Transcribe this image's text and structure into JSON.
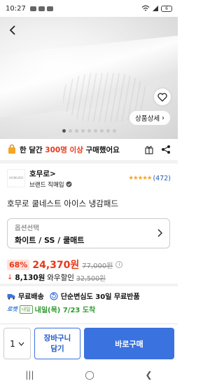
{
  "status_bar": {
    "time": "10:27",
    "battery": "6"
  },
  "hero": {
    "detail_label": "상품상세",
    "slide_count": 9,
    "active_slide": 1
  },
  "notice": {
    "prefix": "한 달간",
    "count": "300명 이상",
    "suffix": "구매했어요"
  },
  "brand": {
    "logo_text": "HOMURO",
    "name": "호무로",
    "name_chevron": ">",
    "sub": "브랜드 직매입",
    "stars": "★★★★★",
    "review_count": "(472)"
  },
  "product": {
    "title": "호무로 쿨네스트 아이스 냉감패드"
  },
  "option": {
    "label": "옵션선택",
    "value": "화이트 / SS / 쿨매트"
  },
  "price": {
    "discount": "68%",
    "sale": "24,370원",
    "original": "77,000원",
    "coupon_amount": "8,130원",
    "coupon_label": "와우할인",
    "coupon_original": "32,500원"
  },
  "delivery": {
    "free_shipping": "무료배송",
    "free_return": "단순변심도 30일 무료반품",
    "rocket_label": "로켓",
    "rocket_tag": "내일",
    "arrival": "내일(목) 7/23 도착"
  },
  "bottom": {
    "quantity": "1",
    "cart_label_1": "장바구니",
    "cart_label_2": "담기",
    "buy_label": "바로구매"
  },
  "colors": {
    "accent": "#3a73e0",
    "sale": "#e8381b",
    "arrival": "#2f9b2f"
  }
}
